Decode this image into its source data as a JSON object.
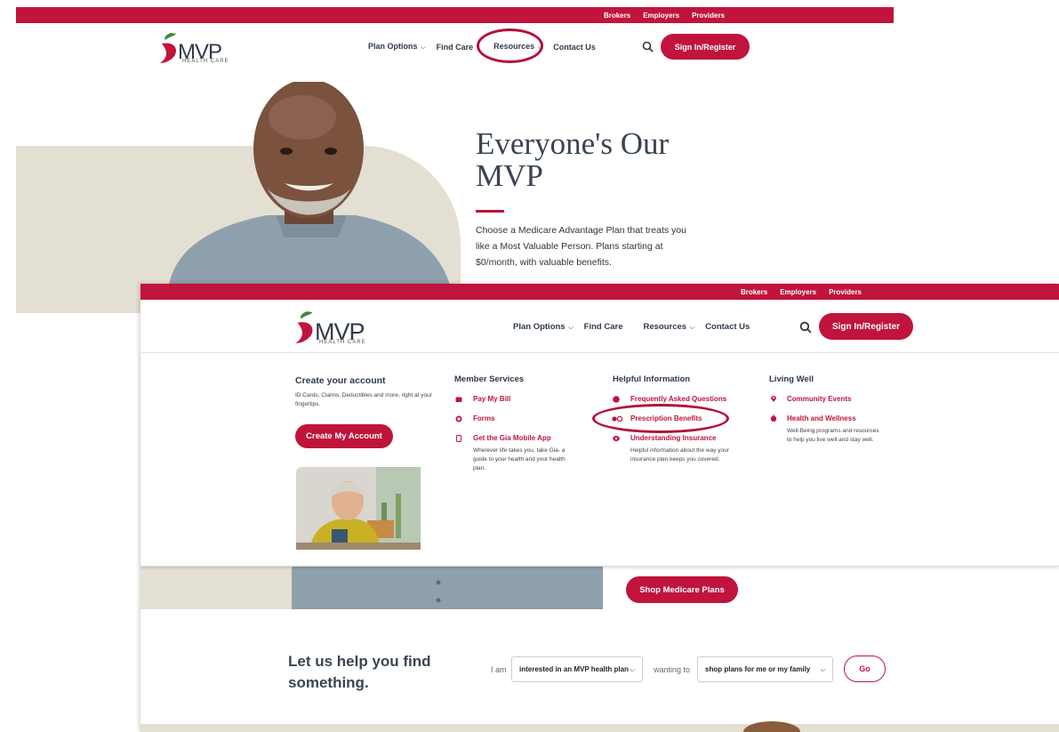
{
  "topbar": {
    "links": [
      "Brokers",
      "Employers",
      "Providers"
    ]
  },
  "brand": {
    "name": "MVP",
    "tagline": "HEALTH CARE",
    "accent": "#c0143c"
  },
  "nav": {
    "plan_options": "Plan Options",
    "find_care": "Find Care",
    "resources": "Resources",
    "contact_us": "Contact Us",
    "sign_in": "Sign In/Register"
  },
  "hero": {
    "title": "Everyone's Our MVP",
    "body": "Choose a Medicare Advantage Plan that treats you like a Most Valuable Person. Plans starting at $0/month, with valuable benefits.",
    "cta": "Shop Medicare Plans"
  },
  "mega_menu": {
    "account": {
      "heading": "Create your account",
      "desc": "ID Cards, Claims, Deductibles and more, right at your fingertips.",
      "button": "Create My Account"
    },
    "member_services": {
      "heading": "Member Services",
      "pay": "Pay My Bill",
      "forms": "Forms",
      "gia": "Get the Gia Mobile App",
      "gia_desc": "Wherever life takes you, take Gia- a guide to your health and your health plan."
    },
    "helpful": {
      "heading": "Helpful Information",
      "faq": "Frequently Asked Questions",
      "rx": "Prescription Benefits",
      "insurance": "Understanding Insurance",
      "insurance_desc": "Helpful information about the way your insurance plan keeps you covered."
    },
    "living_well": {
      "heading": "Living Well",
      "events": "Community Events",
      "health": "Health and Wellness",
      "health_desc": "Well-Being programs and resources to help you live well and stay well."
    }
  },
  "finder": {
    "title": "Let us help you find something.",
    "i_am": "I am",
    "select1": "interested in an MVP health plan",
    "wanting": "wanting to",
    "select2": "shop plans for me or my family",
    "go": "Go"
  }
}
